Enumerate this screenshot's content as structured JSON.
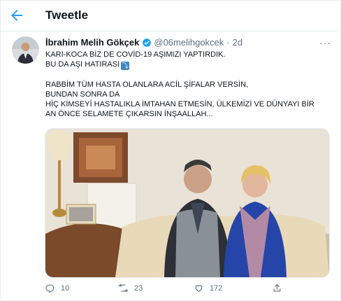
{
  "header": {
    "title": "Tweetle"
  },
  "tweet": {
    "author_name": "İbrahim Melih Gökçek",
    "handle": "@06melihgokcek",
    "separator": "·",
    "time": "2d",
    "more": "···",
    "lines": [
      "KARI-KOCA BİZ DE COVİD-19 AŞIMIZI YAPTIRDIK.",
      "BU DA AŞI HATIRASI",
      "",
      "RABBİM TÜM HASTA OLANLARA ACİL ŞİFALAR VERSİN,",
      "BUNDAN SONRA DA",
      "HİÇ KİMSEYİ HASTALIKLA İMTAHAN ETMESİN, ÜLKEMİZİ VE DÜNYAYI BİR",
      "AN ÖNCE SELAMETE ÇIKARSIN İNŞAALLAH..."
    ]
  },
  "actions": {
    "reply_count": "10",
    "retweet_count": "23",
    "like_count": "172"
  },
  "colors": {
    "accent": "#1da1f2",
    "muted": "#5b7083"
  },
  "icons": [
    "back-arrow-icon",
    "verified-badge-icon",
    "more-icon",
    "reply-icon",
    "retweet-icon",
    "like-icon",
    "share-icon"
  ]
}
